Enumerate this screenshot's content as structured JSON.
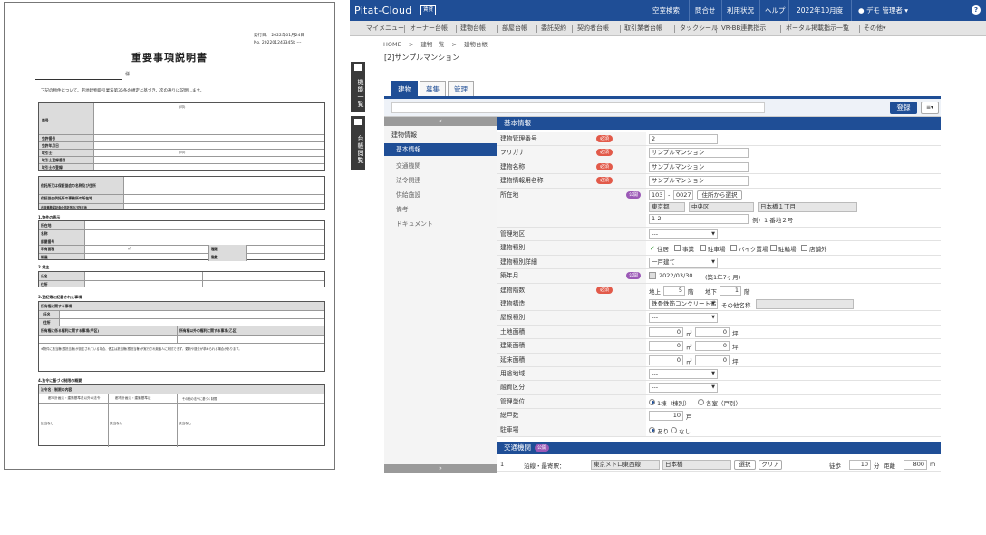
{
  "document": {
    "issue_date": "発行日： 2022年01月24日",
    "doc_no": "No. 202201243345b ---",
    "title": "重要事項説明書",
    "honorific": "様",
    "intro": "下記の物件について、宅地建物取引業法第35条の規定に基づき、次の通りに説明します。",
    "license_table": {
      "rows": [
        "商号",
        "免許番号",
        "免許年月日",
        "取引士",
        "取引士登録番号",
        "取引士の登録"
      ],
      "seal1": "(印)",
      "seal2": "(印)"
    },
    "guarantee_rows": [
      "供託所又は保証協会の名称及び住所",
      "保証協会供託所の事務所の所在地",
      "弁済業務保証金の供託所及び所在地"
    ],
    "sec1_title": "1.物件の表示",
    "sec1_rows": [
      "所在地",
      "名称",
      "部屋番号",
      "専有面積",
      "構造"
    ],
    "sec1_area_unit": "㎡",
    "sec1_extra": [
      "種類",
      "階数"
    ],
    "sec2_title": "2.貸主",
    "sec2_rows": [
      "氏名",
      "住所"
    ],
    "sec3_title": "3.登記簿に記載された事項",
    "sec3_head": "所有権に関する事項",
    "sec3_rows": [
      "氏名",
      "住所"
    ],
    "sec3_cols": [
      "所有権に係る権利に関する事項(甲区)",
      "所有権以外の権利に関する事項(乙区)"
    ],
    "sec3_note": "※物件に抵当権(根抵当権)が設定されている場合、借主は抵当権(根抵当権)が実行され競落人に対抗できず、更新や退去が求められる場合があります。",
    "sec4_title": "4.法令に基づく制限の概要",
    "sec4_head": "法令名・制限の内容",
    "sec4_cols": [
      "都市計画法・建築基準法以外の法令",
      "都市計画法・建築基準法",
      "その他の法令に基づく制限"
    ],
    "sec4_cell": "該当なし"
  },
  "app": {
    "logo": "Pitat-Cloud",
    "logo_badge": "賃貸",
    "top_nav": [
      "空室検索",
      "問合せ",
      "利用状況",
      "ヘルプ",
      "2022年10月度",
      "デモ 管理者"
    ],
    "help_icon": "?",
    "menu": [
      "マイメニュー",
      "オーナー台帳",
      "建物台帳",
      "部屋台帳",
      "委託契約",
      "契約者台帳",
      "取引業者台帳",
      "タックシール",
      "VR-BB連携指示",
      "ポータル掲載指示一覧",
      "その他"
    ],
    "breadcrumb": [
      "HOME",
      ">",
      "建物一覧",
      ">",
      "建物台帳"
    ],
    "page_title": "[2]サンプルマンション",
    "side_tabs": [
      "機能一覧",
      "台帳閲覧"
    ],
    "tabs": [
      "建物",
      "募集",
      "管理"
    ],
    "register_button": "登録",
    "more_button": "≡",
    "lnav_collapse": "«",
    "lnav_expand": "»",
    "lnav_heading": "建物情報",
    "lnav_items": [
      "基本情報",
      "交通機関",
      "法令関連",
      "供給施設",
      "備考",
      "ドキュメント"
    ],
    "section_basic": "基本情報",
    "badge_required": "必須",
    "badge_public": "公開",
    "fields": {
      "building_no": {
        "label": "建物管理番号",
        "value": "2"
      },
      "furigana": {
        "label": "フリガナ",
        "value": "サンプルマンション"
      },
      "name": {
        "label": "建物名称",
        "value": "サンプルマンション"
      },
      "display_name": {
        "label": "建物情報用名称",
        "value": "サンプルマンション"
      },
      "address": {
        "label": "所在地",
        "zip1": "103",
        "dash": "-",
        "zip2": "0027",
        "zip_button": "住所から選択",
        "pref": "東京都",
        "city": "中央区",
        "town": "日本橋１丁目",
        "detail": "1-2",
        "example": "例）1 番地２号"
      },
      "area": {
        "label": "管理地区",
        "value": "---"
      },
      "type": {
        "label": "建物種別",
        "options": [
          "住居",
          "事業",
          "駐車場",
          "バイク置場",
          "駐輪場",
          "店舗外"
        ]
      },
      "type_detail": {
        "label": "建物種別詳細",
        "value": "一戸建て"
      },
      "built": {
        "label": "築年月",
        "value": "2022/03/30",
        "age": "(築1年7ヶ月)"
      },
      "floors": {
        "label": "建物階数",
        "above_label": "地上",
        "above": "5",
        "above_unit": "階",
        "below_label": "地下",
        "below": "1",
        "below_unit": "階"
      },
      "structure": {
        "label": "建物構造",
        "value": "鉄骨鉄筋コンクリート造",
        "other_label": "その他名称"
      },
      "roof": {
        "label": "屋根種別",
        "value": "---"
      },
      "land_area": {
        "label": "土地面積",
        "v1": "0",
        "u1": "㎡",
        "v2": "0",
        "u2": "坪"
      },
      "building_area": {
        "label": "建築面積",
        "v1": "0",
        "u1": "㎡",
        "v2": "0",
        "u2": "坪"
      },
      "floor_area": {
        "label": "延床面積",
        "v1": "0",
        "u1": "㎡",
        "v2": "0",
        "u2": "坪"
      },
      "zoning": {
        "label": "用途地域",
        "value": "---"
      },
      "loan": {
        "label": "融資区分",
        "value": "---"
      },
      "unit": {
        "label": "管理単位",
        "opt1": "1棟（棟別）",
        "opt2": "各室（戸別）"
      },
      "households": {
        "label": "総戸数",
        "value": "10",
        "unit": "戸"
      },
      "parking": {
        "label": "駐車場",
        "opt1": "あり",
        "opt2": "なし"
      }
    },
    "section_transport": "交通機関",
    "transport": {
      "no": "1",
      "label": "沿線・最寄駅：",
      "line": "東京メトロ東西線",
      "station": "日本橋",
      "select_button": "選択",
      "clear_button": "クリア",
      "walk_label": "徒歩",
      "walk": "10",
      "walk_unit": "分",
      "dist_label": "距離",
      "dist": "800",
      "dist_unit": "m"
    }
  }
}
